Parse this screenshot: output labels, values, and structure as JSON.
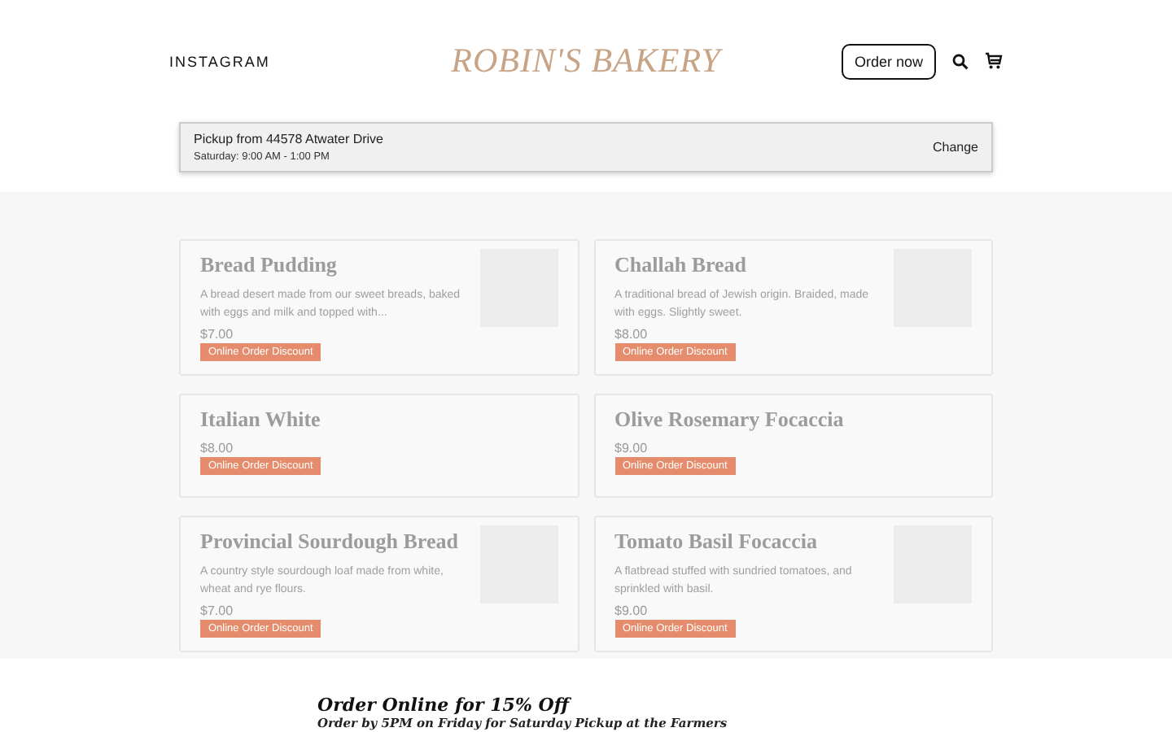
{
  "header": {
    "social_link": "INSTAGRAM",
    "logo": "ROBIN'S BAKERY",
    "order_button": "Order now"
  },
  "pickup": {
    "title": "Pickup from 44578 Atwater Drive",
    "hours": "Saturday: 9:00 AM - 1:00 PM",
    "action": "Change"
  },
  "products": [
    {
      "name": "Bread Pudding",
      "description": "A bread desert made from our sweet breads, baked with eggs and milk and topped with...",
      "price": "$7.00",
      "badge": "Online Order Discount",
      "has_image": true
    },
    {
      "name": "Challah Bread",
      "description": "A traditional bread of Jewish origin. Braided, made with eggs. Slightly sweet.",
      "price": "$8.00",
      "badge": "Online Order Discount",
      "has_image": true
    },
    {
      "name": "Italian White",
      "price": "$8.00",
      "badge": "Online Order Discount",
      "has_image": false
    },
    {
      "name": "Olive Rosemary Focaccia",
      "price": "$9.00",
      "badge": "Online Order Discount",
      "has_image": false
    },
    {
      "name": "Provincial Sourdough Bread",
      "description": "A country style sourdough loaf made from white, wheat and rye flours.",
      "price": "$7.00",
      "badge": "Online Order Discount",
      "has_image": true
    },
    {
      "name": "Tomato Basil Focaccia",
      "description": "A flatbread stuffed with sundried tomatoes, and sprinkled with basil.",
      "price": "$9.00",
      "badge": "Online Order Discount",
      "has_image": true
    }
  ],
  "promo": {
    "heading": "Order Online for 15% Off",
    "subheading": "Order by 5PM on Friday for Saturday Pickup at the Farmers"
  }
}
